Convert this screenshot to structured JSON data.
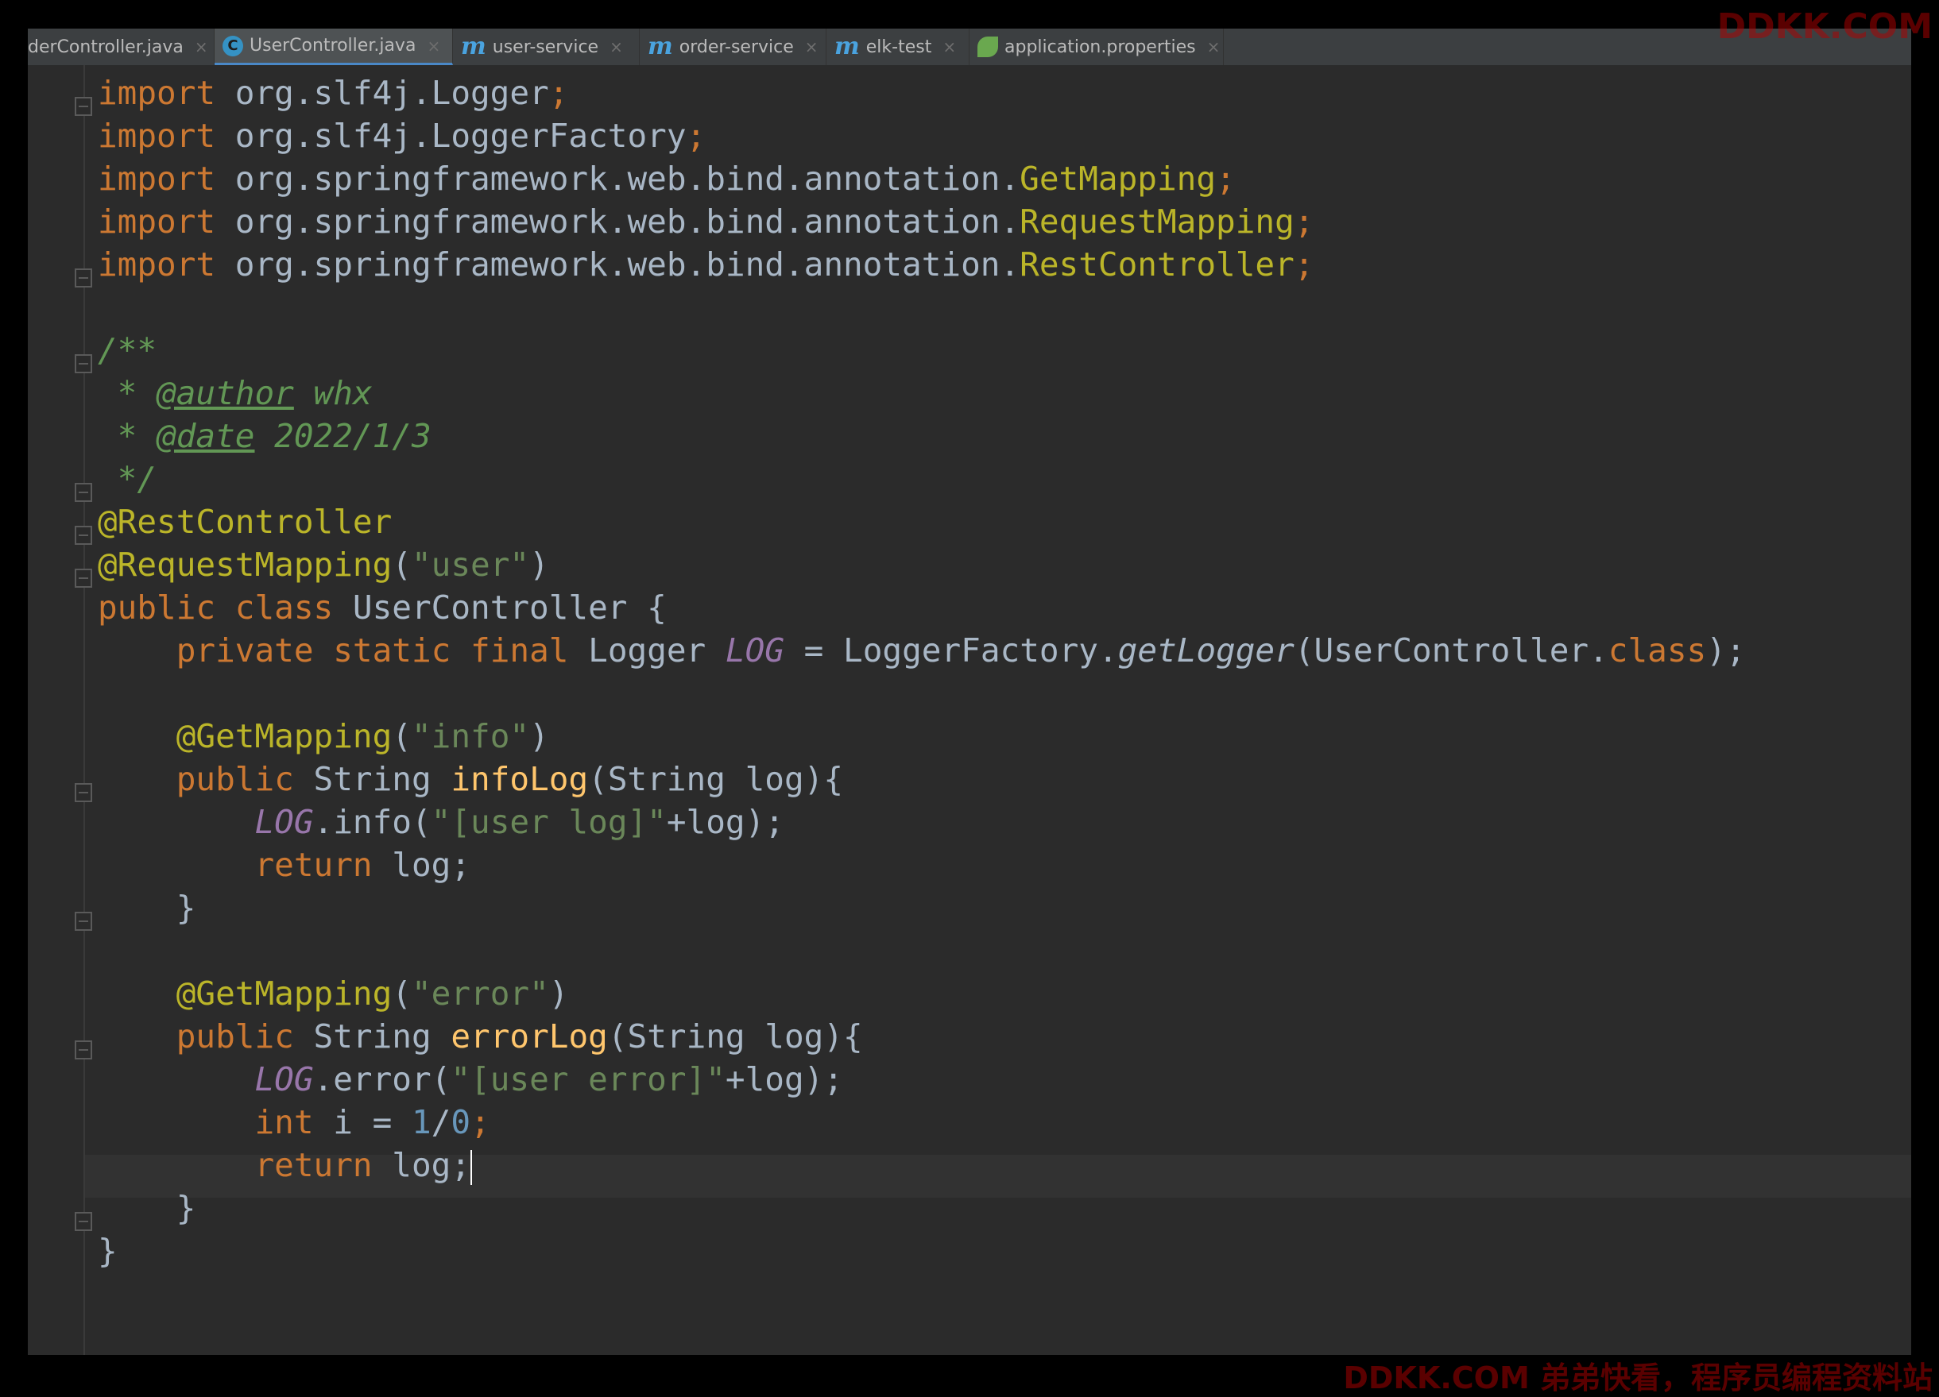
{
  "tabs": [
    {
      "label": "derController.java",
      "icon": "none"
    },
    {
      "label": "UserController.java",
      "icon": "class-icon",
      "active": true
    },
    {
      "label": "user-service",
      "icon": "maven-icon"
    },
    {
      "label": "order-service",
      "icon": "maven-icon"
    },
    {
      "label": "elk-test",
      "icon": "maven-icon"
    },
    {
      "label": "application.properties",
      "icon": "spring-icon"
    }
  ],
  "tab_close_symbol": "×",
  "class_icon_letter": "C",
  "maven_icon_letter": "m",
  "code": {
    "imports": [
      {
        "kw": "import",
        "pkg": " org.slf4j.Logger",
        "end": ";"
      },
      {
        "kw": "import",
        "pkg": " org.slf4j.LoggerFactory",
        "end": ";"
      },
      {
        "kw": "import",
        "pkg": " org.springframework.web.bind.annotation.",
        "cls": "GetMapping",
        "end": ";"
      },
      {
        "kw": "import",
        "pkg": " org.springframework.web.bind.annotation.",
        "cls": "RequestMapping",
        "end": ";"
      },
      {
        "kw": "import",
        "pkg": " org.springframework.web.bind.annotation.",
        "cls": "RestController",
        "end": ";"
      }
    ],
    "doc_open": "/**",
    "doc_star": " * ",
    "author_tag": "@author",
    "author_value": " whx",
    "date_tag": "@date",
    "date_value": " 2022/1/3",
    "doc_close": " */",
    "ann_rest": "@RestController",
    "ann_request": "@RequestMapping",
    "request_path": "\"user\"",
    "kw_public": "public",
    "kw_class": "class",
    "class_name": " UserController {",
    "kw_private": "private",
    "kw_static": "static",
    "kw_final": "final",
    "logger_type": " Logger ",
    "log_field": "LOG",
    "assign": " = LoggerFactory.",
    "get_logger": "getLogger",
    "get_logger_arg": "(UserController.",
    "kw_class_lit": "class",
    "get_logger_end": ");",
    "ann_get": "@GetMapping",
    "info_path": "\"info\"",
    "info_method": "infoLog",
    "string_type": " String ",
    "params": "(String log){",
    "info_call": ".info(",
    "info_str": "\"[user log]\"",
    "concat_log": "+log);",
    "kw_return": "return",
    "return_log": " log;",
    "close_brace": "}",
    "error_path": "\"error\"",
    "error_method": "errorLog",
    "error_call": ".error(",
    "error_str": "\"[user error]\"",
    "kw_int": "int",
    "int_decl": " i = ",
    "num_one": "1",
    "slash": "/",
    "num_zero": "0",
    "semicolon": ";",
    "open_paren": "(",
    "close_paren": ")",
    "space": " ",
    "indent1": "    ",
    "indent2": "        "
  },
  "watermark_top": "DDKK.COM",
  "watermark_bottom": "DDKK.COM 弟弟快看，程序员编程资料站"
}
